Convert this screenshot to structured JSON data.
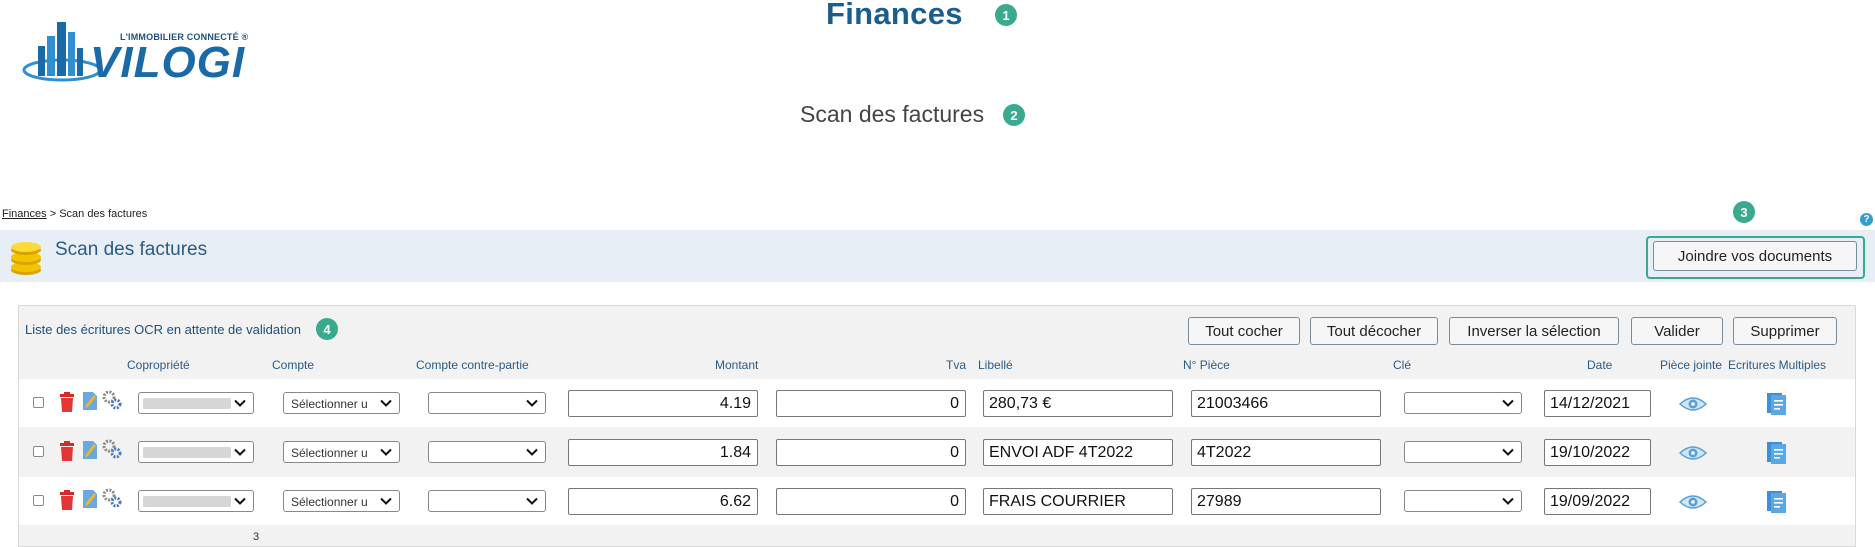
{
  "annotations": [
    "1",
    "2",
    "3",
    "4"
  ],
  "header": {
    "title": "Finances",
    "subtitle": "Scan des factures"
  },
  "logo": {
    "tagline": "L'IMMOBILIER CONNECTÉ ®",
    "wordmark": "VILOGI"
  },
  "breadcrumb": {
    "link": "Finances",
    "separator": " > ",
    "current": "Scan des factures"
  },
  "page": {
    "heading": "Scan des factures",
    "help": "?"
  },
  "toolbar": {
    "join_label": "Joindre vos documents"
  },
  "panel": {
    "title": "Liste des écritures OCR en attente de validation",
    "buttons": {
      "check_all": "Tout cocher",
      "uncheck_all": "Tout décocher",
      "invert": "Inverser la sélection",
      "validate": "Valider",
      "delete": "Supprimer"
    },
    "columns": {
      "copro": "Copropriété",
      "compte": "Compte",
      "contre": "Compte contre-partie",
      "montant": "Montant",
      "tva": "Tva",
      "libelle": "Libellé",
      "piece": "N° Pièce",
      "cle": "Clé",
      "date": "Date",
      "pj": "Pièce jointe",
      "ecritures": "Ecritures Multiples"
    },
    "rows": [
      {
        "compte": "Sélectionner u",
        "montant": "4.19",
        "tva": "0",
        "libelle": "280,73 €",
        "piece": "21003466",
        "date": "14/12/2021"
      },
      {
        "compte": "Sélectionner u",
        "montant": "1.84",
        "tva": "0",
        "libelle": "ENVOI ADF 4T2022",
        "piece": "4T2022",
        "date": "19/10/2022"
      },
      {
        "compte": "Sélectionner u",
        "montant": "6.62",
        "tva": "0",
        "libelle": "FRAIS COURRIER",
        "piece": "27989",
        "date": "19/09/2022"
      }
    ],
    "count": "3"
  },
  "icons": [
    "building-logo-icon",
    "coins-icon",
    "help-icon",
    "trash-icon",
    "edit-icon",
    "gears-icon",
    "eye-icon",
    "document-icon",
    "chevron-down-icon"
  ],
  "colors": {
    "accent_teal": "#3aaa8e",
    "brand_blue": "#1b6aa8",
    "header_band": "#e7eef5",
    "trash_red": "#d42a2a"
  }
}
